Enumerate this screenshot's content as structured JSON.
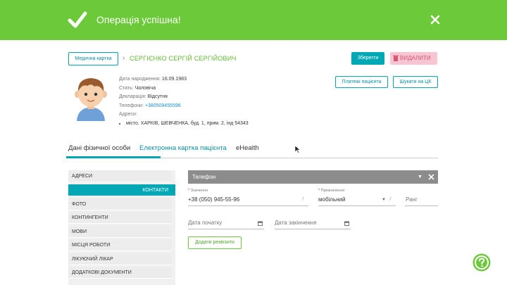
{
  "banner": {
    "message": "Операція успішна!",
    "color": "#6cc93a",
    "check_icon": "check-icon",
    "close_icon": "close-icon"
  },
  "header": {
    "card_button": "Медична картка",
    "patient_name": "СЕРГІЄНКО СЕРГІЙ СЕРГІЙОВИЧ",
    "save_button": "Зберегти",
    "delete_button": "ВИДАЛИТИ"
  },
  "patient": {
    "birth_label": "Дата народження:",
    "birth_value": "16.09.1983",
    "sex_label": "Стать:",
    "sex_value": "Чоловіча",
    "declaration_label": "Декларація:",
    "declaration_value": "Відсутня",
    "phone_label": "Телефони:",
    "phone_value": "+380509455596",
    "address_label": "Адреси:",
    "address_value": "місто. ХАРКІВ, ШЕВЧЕНКА, буд. 1, прим. 2, інд 54343",
    "payments_button": "Платежі пацієнта",
    "search_cz_button": "Шукати на ЦК"
  },
  "tabs": [
    {
      "label": "Дані фізичної особи"
    },
    {
      "label": "Електронна картка пацієнта"
    },
    {
      "label": "eHealth"
    }
  ],
  "sidebar": {
    "items": [
      {
        "label": "АДРЕСИ"
      },
      {
        "label": "КОНТАКТИ"
      },
      {
        "label": "ФОТО"
      },
      {
        "label": "КОНТИНГЕНТИ"
      },
      {
        "label": "МОВИ"
      },
      {
        "label": "МІСЦЯ РОБОТИ"
      },
      {
        "label": "ЛІКУЮЧИЙ ЛІКАР"
      },
      {
        "label": "ДОДАТКОВІ ДОКУМЕНТИ"
      }
    ]
  },
  "panel": {
    "title": "Телефон",
    "value_label": "Значення",
    "value": "+38 (050) 945-55-96",
    "purpose_label": "Призначення",
    "purpose_value": "мобільний",
    "rank_placeholder": "Ранг",
    "start_date_placeholder": "Дата початку",
    "end_date_placeholder": "Дата закінчення",
    "add_button": "Додати реквізити"
  },
  "colors": {
    "accent": "#00a7b5",
    "success": "#6cc93a",
    "danger": "#d9536f"
  }
}
